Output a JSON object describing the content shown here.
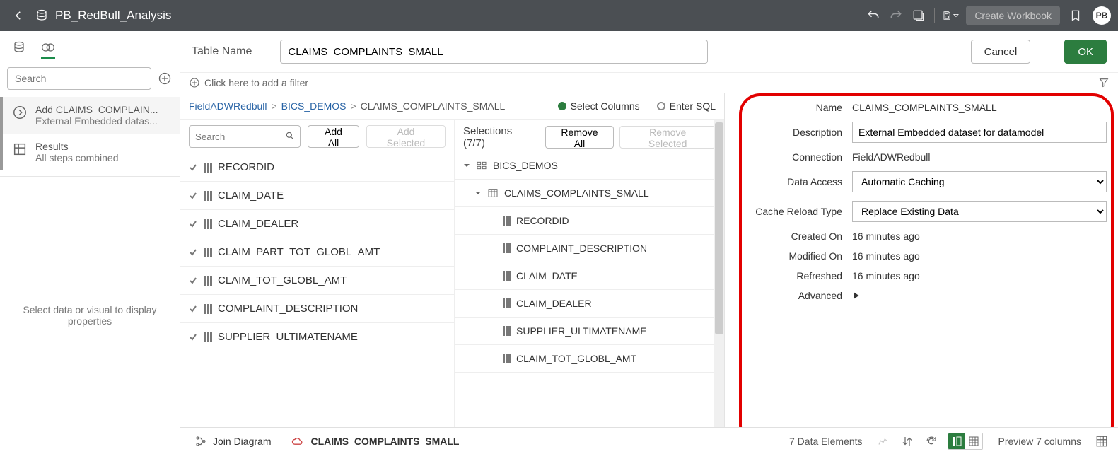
{
  "header": {
    "title": "PB_RedBull_Analysis",
    "createWorkbook": "Create Workbook",
    "avatar": "PB"
  },
  "sidebar": {
    "searchPlaceholder": "Search",
    "steps": [
      {
        "l1": "Add CLAIMS_COMPLAIN...",
        "l2": "External Embedded datas..."
      },
      {
        "l1": "Results",
        "l2": "All steps combined"
      }
    ],
    "emptyProp": "Select data or visual to display properties"
  },
  "toolbar": {
    "tableNameLabel": "Table Name",
    "tableName": "CLAIMS_COMPLAINTS_SMALL",
    "cancel": "Cancel",
    "ok": "OK"
  },
  "filter": {
    "hint": "Click here to add a filter"
  },
  "breadcrumb": {
    "a": "FieldADWRedbull",
    "b": "BICS_DEMOS",
    "c": "CLAIMS_COMPLAINTS_SMALL",
    "selectColumns": "Select Columns",
    "enterSql": "Enter SQL"
  },
  "buttons": {
    "addAll": "Add All",
    "addSelected": "Add Selected",
    "removeAll": "Remove All",
    "removeSelected": "Remove Selected",
    "searchPlaceholder": "Search"
  },
  "selections": {
    "label": "Selections (7/7)"
  },
  "available": [
    "RECORDID",
    "CLAIM_DATE",
    "CLAIM_DEALER",
    "CLAIM_PART_TOT_GLOBL_AMT",
    "CLAIM_TOT_GLOBL_AMT",
    "COMPLAINT_DESCRIPTION",
    "SUPPLIER_ULTIMATENAME"
  ],
  "tree": {
    "schema": "BICS_DEMOS",
    "table": "CLAIMS_COMPLAINTS_SMALL",
    "cols": [
      "RECORDID",
      "COMPLAINT_DESCRIPTION",
      "CLAIM_DATE",
      "CLAIM_DEALER",
      "SUPPLIER_ULTIMATENAME",
      "CLAIM_TOT_GLOBL_AMT"
    ]
  },
  "detail": {
    "labels": {
      "name": "Name",
      "description": "Description",
      "connection": "Connection",
      "dataAccess": "Data Access",
      "cacheReload": "Cache Reload Type",
      "createdOn": "Created On",
      "modifiedOn": "Modified On",
      "refreshed": "Refreshed",
      "advanced": "Advanced"
    },
    "name": "CLAIMS_COMPLAINTS_SMALL",
    "description": "External Embedded dataset for datamodel",
    "connection": "FieldADWRedbull",
    "dataAccess": "Automatic Caching",
    "cacheReload": "Replace Existing Data",
    "createdOn": "16 minutes ago",
    "modifiedOn": "16 minutes ago",
    "refreshed": "16 minutes ago"
  },
  "bottom": {
    "joinDiagram": "Join Diagram",
    "activeTab": "CLAIMS_COMPLAINTS_SMALL",
    "elements": "7 Data Elements",
    "preview": "Preview 7 columns"
  }
}
